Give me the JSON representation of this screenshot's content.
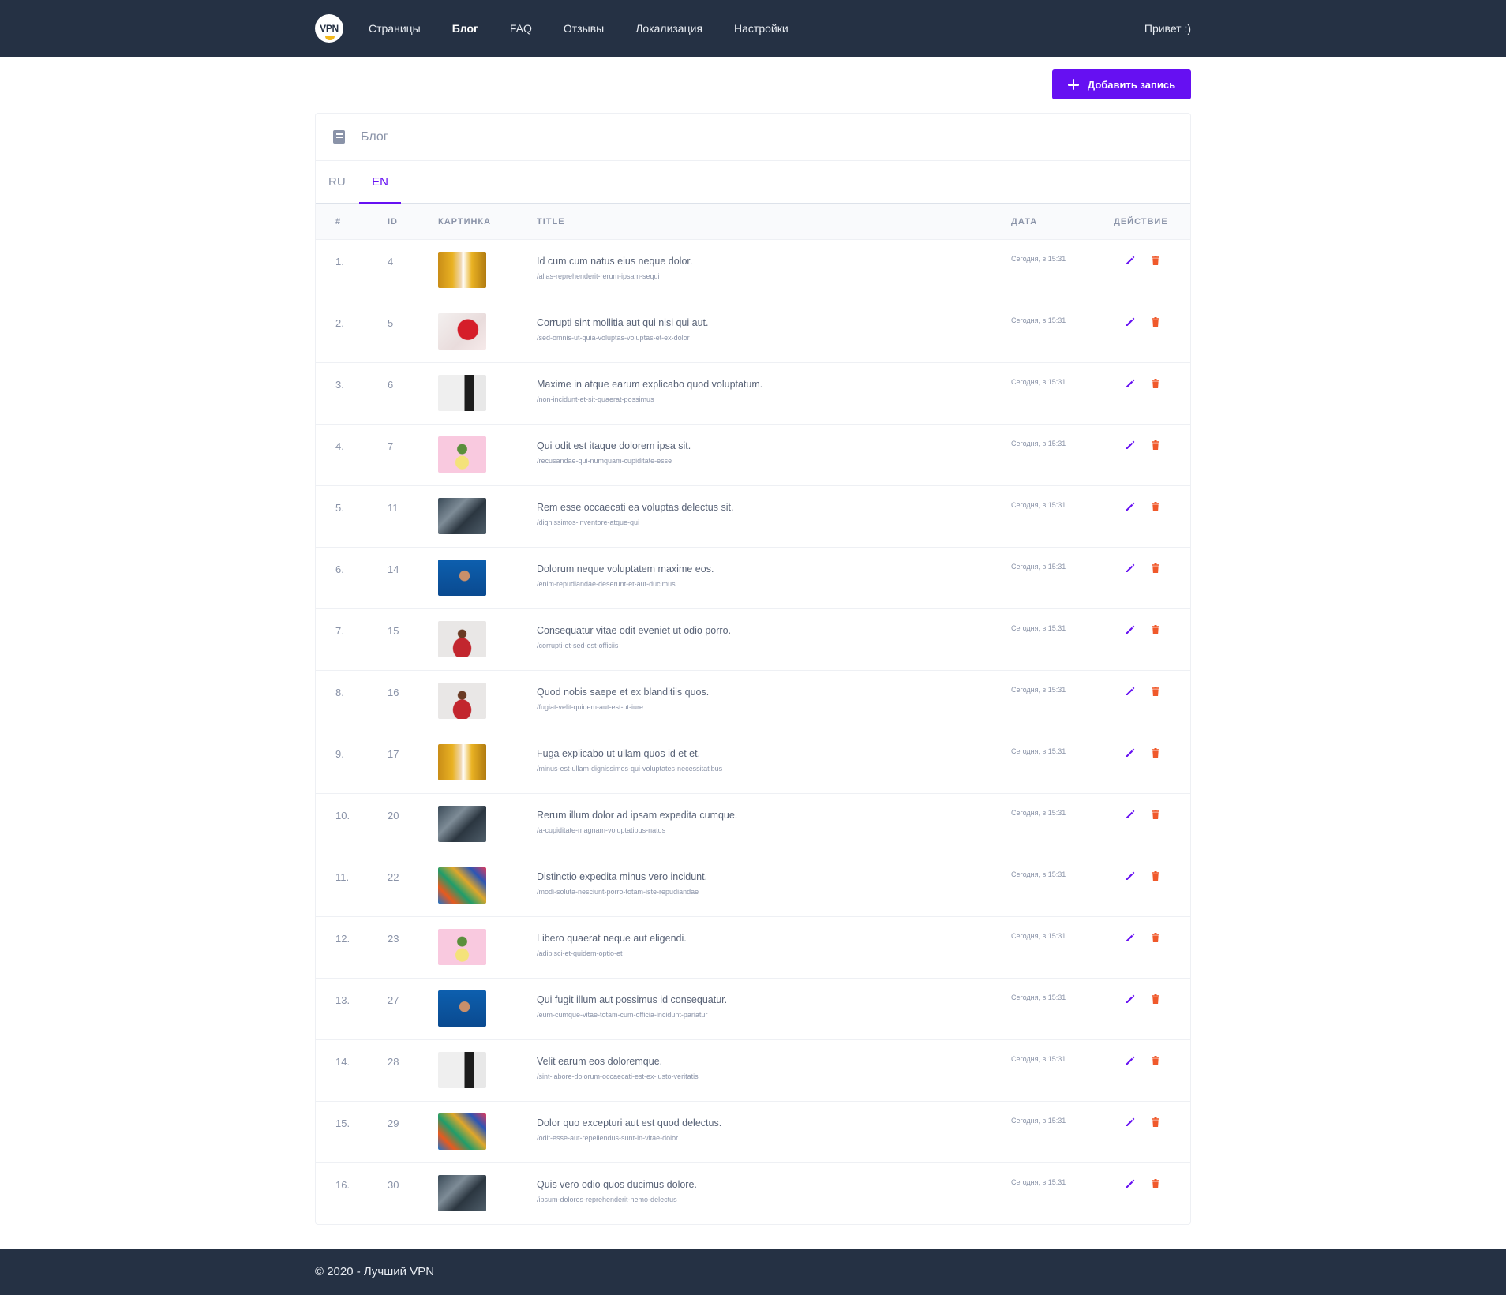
{
  "nav": {
    "logo_text": "VPN",
    "links": [
      "Страницы",
      "Блог",
      "FAQ",
      "Отзывы",
      "Локализация",
      "Настройки"
    ],
    "active_index": 1,
    "greeting": "Привет :)"
  },
  "toolbar": {
    "add_label": "Добавить запись"
  },
  "card": {
    "title": "Блог"
  },
  "tabs": [
    {
      "label": "RU"
    },
    {
      "label": "EN"
    }
  ],
  "active_tab": "EN",
  "table": {
    "headers": {
      "num": "#",
      "id": "ID",
      "image": "Картинка",
      "title": "Title",
      "date": "Дата",
      "action": "Действие"
    },
    "rows": [
      {
        "num": "1.",
        "id": "4",
        "thumb": "woman",
        "title": "Id cum cum natus eius neque dolor.",
        "slug": "/alias-reprehenderit-rerum-ipsam-sequi",
        "date": "Сегодня, в 15:31"
      },
      {
        "num": "2.",
        "id": "5",
        "thumb": "flower",
        "title": "Corrupti sint mollitia aut qui nisi qui aut.",
        "slug": "/sed-omnis-ut-quia-voluptas-voluptas-et-ex-dolor",
        "date": "Сегодня, в 15:31"
      },
      {
        "num": "3.",
        "id": "6",
        "thumb": "desk",
        "title": "Maxime in atque earum explicabo quod voluptatum.",
        "slug": "/non-incidunt-et-sit-quaerat-possimus",
        "date": "Сегодня, в 15:31"
      },
      {
        "num": "4.",
        "id": "7",
        "thumb": "plant",
        "title": "Qui odit est itaque dolorem ipsa sit.",
        "slug": "/recusandae-qui-numquam-cupiditate-esse",
        "date": "Сегодня, в 15:31"
      },
      {
        "num": "5.",
        "id": "11",
        "thumb": "tech",
        "title": "Rem esse occaecati ea voluptas delectus sit.",
        "slug": "/dignissimos-inventore-atque-qui",
        "date": "Сегодня, в 15:31"
      },
      {
        "num": "6.",
        "id": "14",
        "thumb": "blue",
        "title": "Dolorum neque voluptatem maxime eos.",
        "slug": "/enim-repudiandae-deserunt-et-aut-ducimus",
        "date": "Сегодня, в 15:31"
      },
      {
        "num": "7.",
        "id": "15",
        "thumb": "red",
        "title": "Consequatur vitae odit eveniet ut odio porro.",
        "slug": "/corrupti-et-sed-est-officiis",
        "date": "Сегодня, в 15:31"
      },
      {
        "num": "8.",
        "id": "16",
        "thumb": "red",
        "title": "Quod nobis saepe et ex blanditiis quos.",
        "slug": "/fugiat-velit-quidem-aut-est-ut-iure",
        "date": "Сегодня, в 15:31"
      },
      {
        "num": "9.",
        "id": "17",
        "thumb": "woman",
        "title": "Fuga explicabo ut ullam quos id et et.",
        "slug": "/minus-est-ullam-dignissimos-qui-voluptates-necessitatibus",
        "date": "Сегодня, в 15:31"
      },
      {
        "num": "10.",
        "id": "20",
        "thumb": "tech",
        "title": "Rerum illum dolor ad ipsam expedita cumque.",
        "slug": "/a-cupiditate-magnam-voluptatibus-natus",
        "date": "Сегодня, в 15:31"
      },
      {
        "num": "11.",
        "id": "22",
        "thumb": "colors",
        "title": "Distinctio expedita minus vero incidunt.",
        "slug": "/modi-soluta-nesciunt-porro-totam-iste-repudiandae",
        "date": "Сегодня, в 15:31"
      },
      {
        "num": "12.",
        "id": "23",
        "thumb": "plant",
        "title": "Libero quaerat neque aut eligendi.",
        "slug": "/adipisci-et-quidem-optio-et",
        "date": "Сегодня, в 15:31"
      },
      {
        "num": "13.",
        "id": "27",
        "thumb": "blue",
        "title": "Qui fugit illum aut possimus id consequatur.",
        "slug": "/eum-cumque-vitae-totam-cum-officia-incidunt-pariatur",
        "date": "Сегодня, в 15:31"
      },
      {
        "num": "14.",
        "id": "28",
        "thumb": "desk",
        "title": "Velit earum eos doloremque.",
        "slug": "/sint-labore-dolorum-occaecati-est-ex-iusto-veritatis",
        "date": "Сегодня, в 15:31"
      },
      {
        "num": "15.",
        "id": "29",
        "thumb": "colors",
        "title": "Dolor quo excepturi aut est quod delectus.",
        "slug": "/odit-esse-aut-repellendus-sunt-in-vitae-dolor",
        "date": "Сегодня, в 15:31"
      },
      {
        "num": "16.",
        "id": "30",
        "thumb": "tech",
        "title": "Quis vero odio quos ducimus dolore.",
        "slug": "/ipsum-dolores-reprehenderit-nemo-delectus",
        "date": "Сегодня, в 15:31"
      }
    ]
  },
  "icons": {
    "edit": "pencil-icon",
    "delete": "trash-icon",
    "header": "book-icon",
    "add": "plus-icon"
  },
  "colors": {
    "accent": "#6610f2",
    "danger": "#f0592b",
    "navbar": "#253144"
  },
  "footer": {
    "text": "© 2020 - Лучший VPN"
  }
}
